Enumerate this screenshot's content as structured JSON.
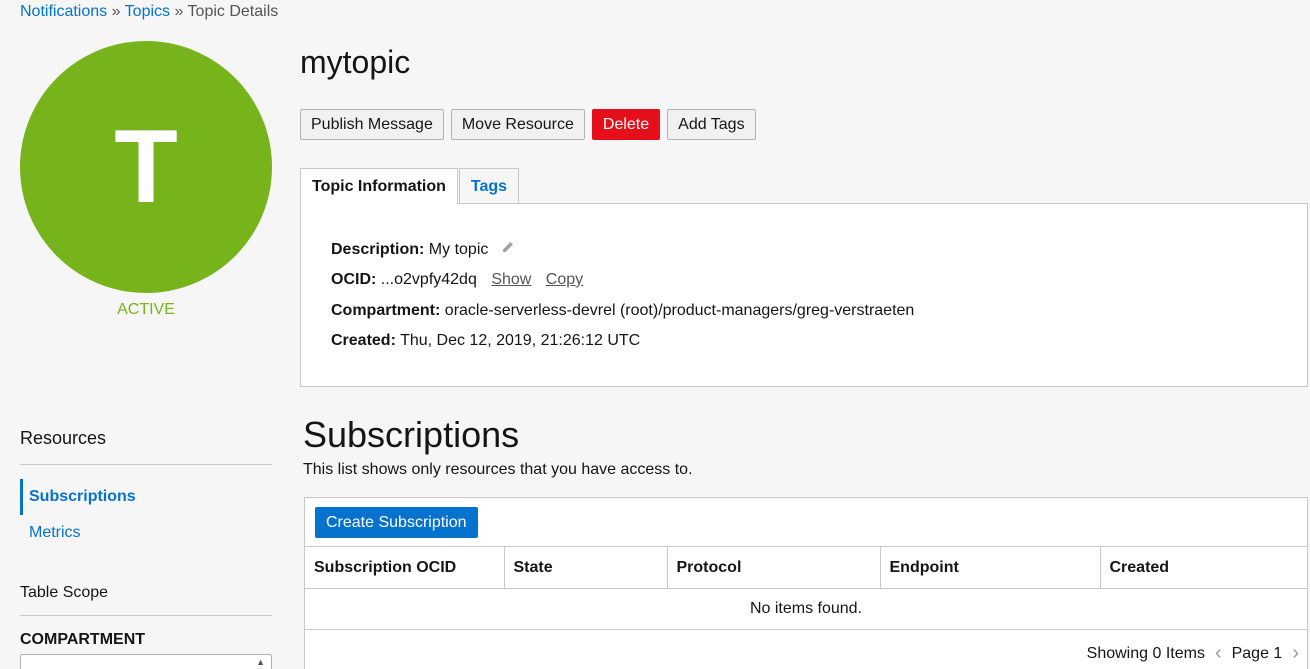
{
  "breadcrumb": {
    "items": [
      "Notifications",
      "Topics"
    ],
    "separator": "»",
    "current": "Topic Details"
  },
  "avatar": {
    "letter": "T",
    "color": "#77b31a"
  },
  "status": "ACTIVE",
  "title": "mytopic",
  "actions": {
    "publish": "Publish Message",
    "move": "Move Resource",
    "delete": "Delete",
    "tags": "Add Tags"
  },
  "tabs": {
    "info": "Topic Information",
    "tags": "Tags"
  },
  "info": {
    "description_label": "Description:",
    "description_value": "My topic",
    "ocid_label": "OCID:",
    "ocid_value": "...o2vpfy42dq",
    "show": "Show",
    "copy": "Copy",
    "compartment_label": "Compartment:",
    "compartment_value": "oracle-serverless-devrel (root)/product-managers/greg-verstraeten",
    "created_label": "Created:",
    "created_value": "Thu, Dec 12, 2019, 21:26:12 UTC"
  },
  "resources": {
    "title": "Resources",
    "items": [
      "Subscriptions",
      "Metrics"
    ]
  },
  "scope": {
    "title": "Table Scope",
    "compartment_label": "COMPARTMENT"
  },
  "subscriptions": {
    "title": "Subscriptions",
    "description": "This list shows only resources that you have access to.",
    "create_button": "Create Subscription",
    "columns": [
      "Subscription OCID",
      "State",
      "Protocol",
      "Endpoint",
      "Created"
    ],
    "empty": "No items found.",
    "showing": "Showing 0 Items",
    "page": "Page 1"
  },
  "colors": {
    "accent": "#0572ce",
    "danger": "#e40f1a",
    "active": "#77b31a"
  }
}
